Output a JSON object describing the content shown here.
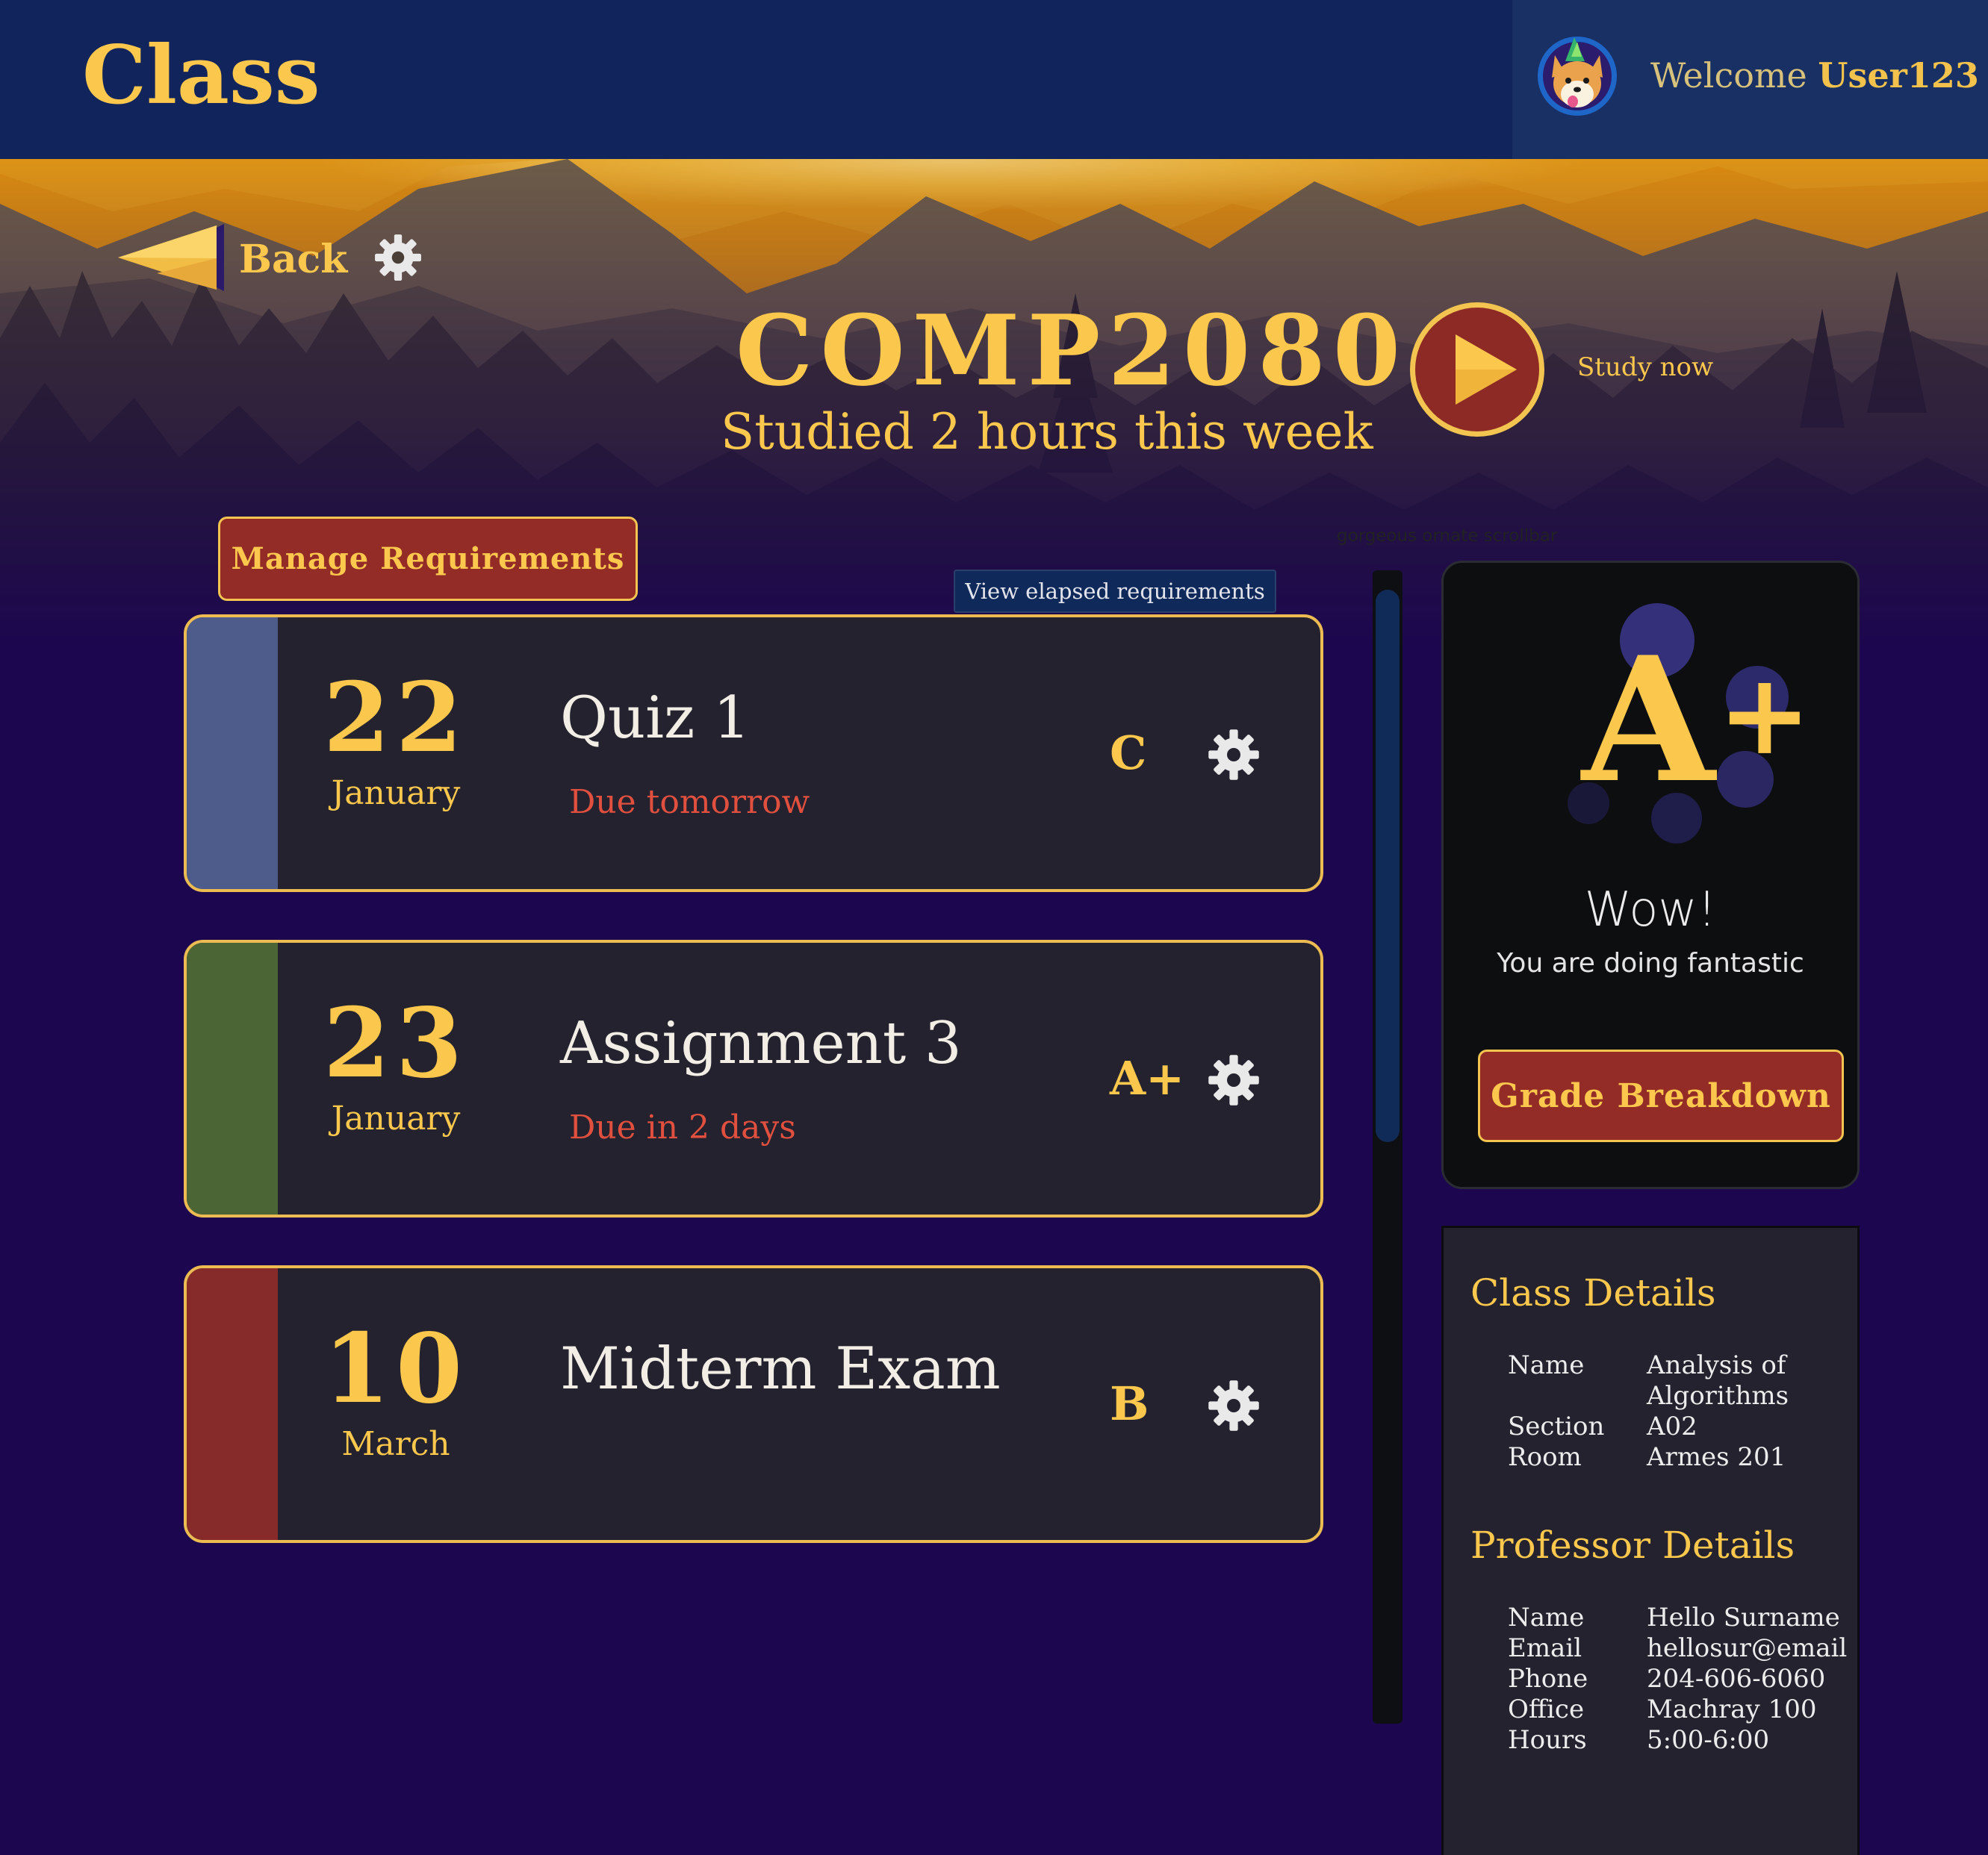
{
  "header": {
    "brand": "Class",
    "welcome_prefix": "Welcome",
    "username": "User123",
    "avatar_icon": "corgi-avatar-icon"
  },
  "hero": {
    "back_label": "Back",
    "course_code": "COMP2080",
    "study_summary": "Studied 2 hours this week",
    "study_now_label": "Study now",
    "scrollbar_note": "gorgeous ornate scrollbar"
  },
  "actions": {
    "manage_label": "Manage Requirements",
    "elapsed_label": "View elapsed requirements"
  },
  "requirements": [
    {
      "day": "22",
      "month": "January",
      "title": "Quiz 1",
      "due": "Due tomorrow",
      "grade": "C",
      "stripe_color": "#4e5c8c"
    },
    {
      "day": "23",
      "month": "January",
      "title": "Assignment 3",
      "due": "Due in 2 days",
      "grade": "A+",
      "stripe_color": "#4c6534"
    },
    {
      "day": "10",
      "month": "March",
      "title": "Midterm Exam",
      "due": "",
      "grade": "B",
      "stripe_color": "#862a2a"
    }
  ],
  "grade_summary": {
    "letter": "A",
    "modifier": "+",
    "headline": "Wow!",
    "message": "You are doing fantastic",
    "breakdown_label": "Grade Breakdown"
  },
  "class_details": {
    "heading": "Class Details",
    "rows": [
      {
        "key": "Name",
        "value": "Analysis of Algorithms"
      },
      {
        "key": "Section",
        "value": "A02"
      },
      {
        "key": "Room",
        "value": "Armes 201"
      }
    ]
  },
  "professor_details": {
    "heading": "Professor Details",
    "rows": [
      {
        "key": "Name",
        "value": "Hello Surname"
      },
      {
        "key": "Email",
        "value": "hellosur@email"
      },
      {
        "key": "Phone",
        "value": "204-606-6060"
      },
      {
        "key": "Office",
        "value": "Machray 100"
      },
      {
        "key": "Hours",
        "value": "5:00-6:00"
      }
    ]
  },
  "colors": {
    "accent": "#fbc74d",
    "button_red": "#932b27",
    "header_navy": "#12245c",
    "background_purple": "#1c0650",
    "due_red": "#e1503f"
  }
}
